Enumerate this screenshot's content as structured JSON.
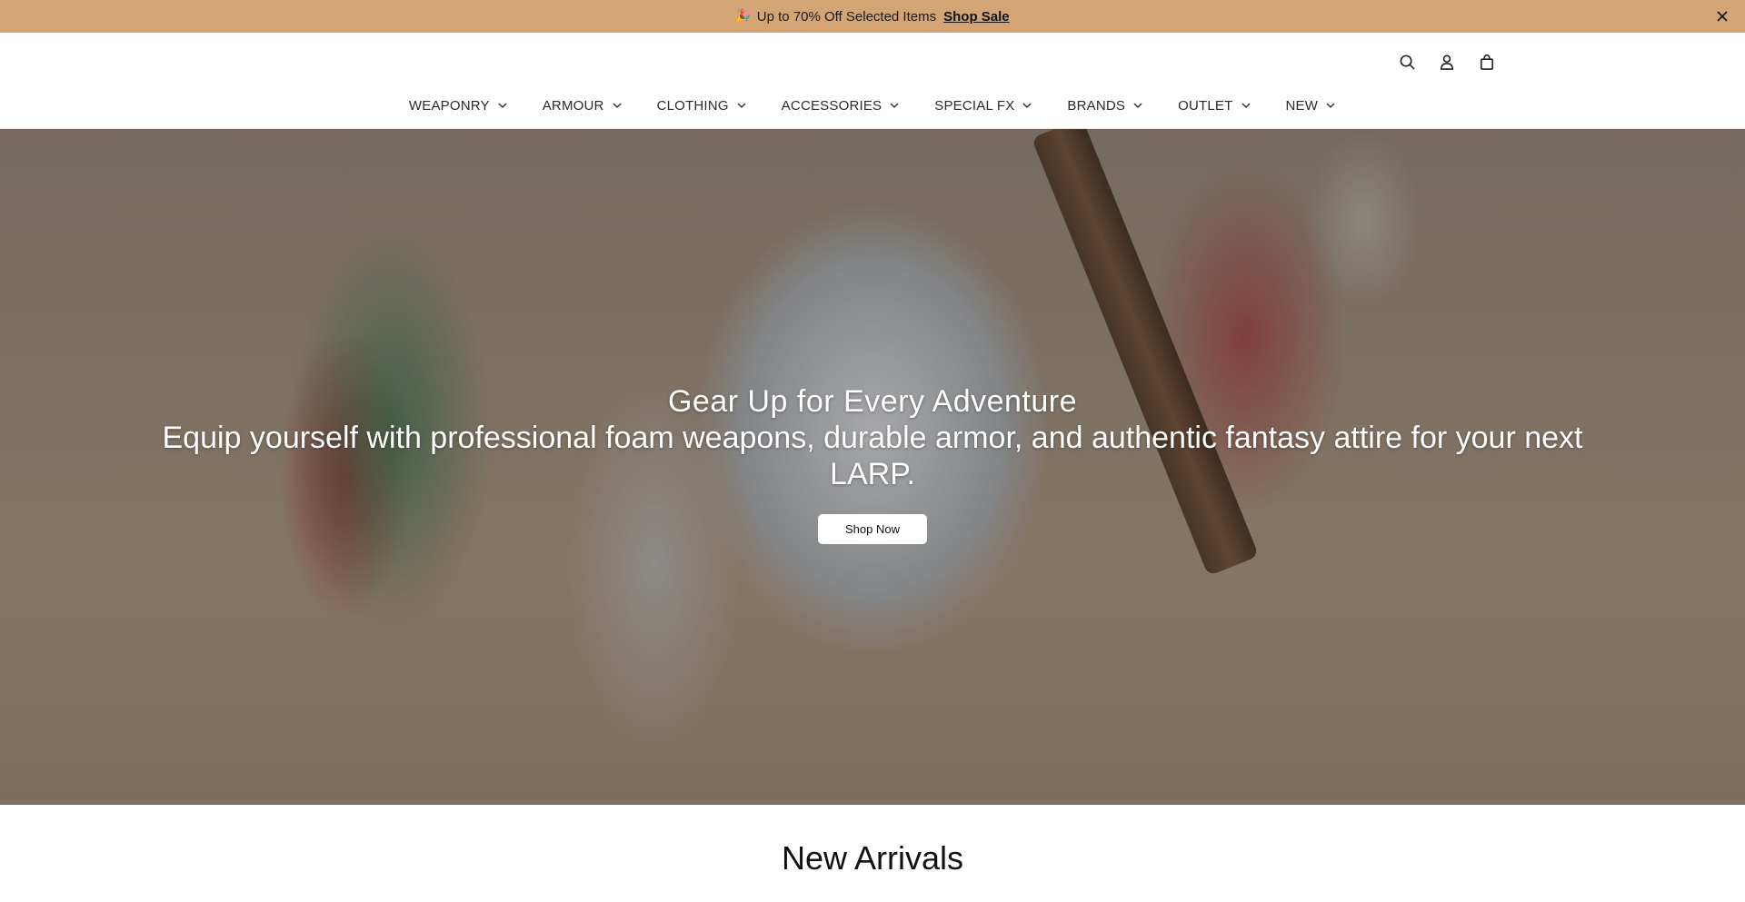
{
  "announcement": {
    "emoji": "🎉",
    "message": "Up to 70% Off Selected Items",
    "link": "Shop Sale",
    "close_icon": "close-icon"
  },
  "header": {
    "icons": [
      "search-icon",
      "account-icon",
      "cart-icon"
    ]
  },
  "nav": {
    "items": [
      {
        "label": "WEAPONRY"
      },
      {
        "label": "ARMOUR"
      },
      {
        "label": "CLOTHING"
      },
      {
        "label": "ACCESSORIES"
      },
      {
        "label": "SPECIAL FX"
      },
      {
        "label": "BRANDS"
      },
      {
        "label": "OUTLET"
      },
      {
        "label": "NEW"
      }
    ]
  },
  "hero": {
    "title": "Gear Up for Every Adventure",
    "subtitle": "Equip yourself with professional foam weapons, durable armor, and authentic fantasy attire for your next LARP.",
    "button": "Shop Now"
  },
  "sections": {
    "new_arrivals": "New Arrivals"
  },
  "colors": {
    "announcement_bg": "#d4a574",
    "text": "#222222"
  }
}
